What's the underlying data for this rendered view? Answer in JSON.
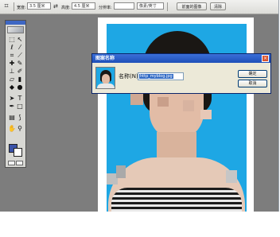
{
  "options_bar": {
    "tool_icon": "crop-tool-icon",
    "width_label": "宽度:",
    "width_value": "3.5 厘米",
    "swap_icon": "swap-arrows-icon",
    "height_label": "高度:",
    "height_value": "4.5 厘米",
    "resolution_label": "分辨率:",
    "resolution_value": "",
    "resolution_unit": "像素/英寸",
    "front_image_button": "前面的图像",
    "clear_button": "清除"
  },
  "toolbox": {
    "tools": [
      "marquee-tool-icon",
      "move-tool-icon",
      "lasso-tool-icon",
      "magic-wand-icon",
      "crop-tool-icon",
      "slice-tool-icon",
      "healing-brush-icon",
      "brush-tool-icon",
      "clone-stamp-icon",
      "history-brush-icon",
      "eraser-tool-icon",
      "gradient-tool-icon",
      "blur-tool-icon",
      "dodge-tool-icon",
      "path-select-icon",
      "type-tool-icon",
      "pen-tool-icon",
      "shape-tool-icon",
      "notes-tool-icon",
      "eyedropper-icon",
      "hand-tool-icon",
      "zoom-tool-icon"
    ],
    "foreground_color": "#3a52a8",
    "background_color": "#ffffff"
  },
  "dialog": {
    "title": "图案名称",
    "name_label": "名称(N):",
    "name_value": "http_myblog.jpg",
    "ok_button": "确定",
    "cancel_button": "取消"
  },
  "colors": {
    "photo_background": "#1ea7e4",
    "titlebar": "#1e4fb8",
    "workspace": "#7d7d7d"
  }
}
